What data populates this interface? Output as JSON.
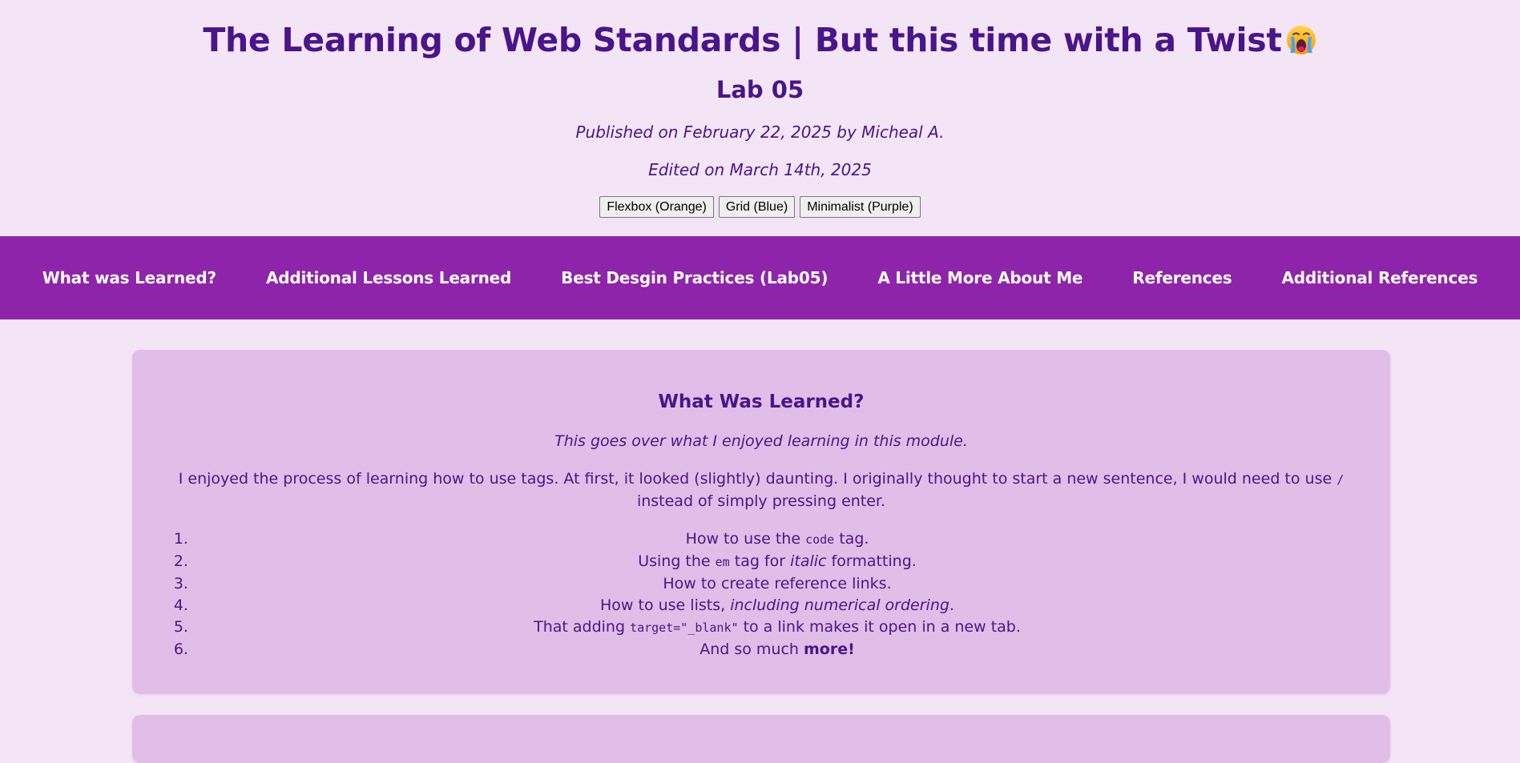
{
  "header": {
    "title": "The Learning of Web Standards | But this time with a Twist",
    "title_emoji_icon": "crying-face-emoji-icon",
    "lab_title": "Lab 05",
    "published": "Published on February 22, 2025 by Micheal A.",
    "edited": "Edited on March 14th, 2025",
    "theme_buttons": [
      "Flexbox (Orange)",
      "Grid (Blue)",
      "Minimalist (Purple)"
    ]
  },
  "nav": {
    "links": [
      "What was Learned?",
      "Additional Lessons Learned",
      "Best Desgin Practices (Lab05)",
      "A Little More About Me",
      "References",
      "Additional References"
    ]
  },
  "section_learned": {
    "title": "What Was Learned?",
    "subtitle": "This goes over what I enjoyed learning in this module.",
    "body_pre": "I enjoyed the process of learning how to use tags. At first, it looked (slightly) daunting. I originally thought to start a new sentence, I would need to use",
    "body_code": "/",
    "body_post": "instead of simply pressing enter.",
    "list": [
      {
        "pre": "How to use the ",
        "code": "code",
        "mid": " tag.",
        "em": "",
        "post": "",
        "strong": ""
      },
      {
        "pre": "Using the ",
        "code": "em",
        "mid": " tag for ",
        "em": "italic",
        "post": " formatting.",
        "strong": ""
      },
      {
        "pre": "How to create reference links.",
        "code": "",
        "mid": "",
        "em": "",
        "post": "",
        "strong": ""
      },
      {
        "pre": "How to use lists, ",
        "code": "",
        "mid": "",
        "em": "including numerical ordering",
        "post": ".",
        "strong": ""
      },
      {
        "pre": "That adding ",
        "code": "target=\"_blank\"",
        "mid": " to a link makes it open in a new tab.",
        "em": "",
        "post": "",
        "strong": ""
      },
      {
        "pre": "And so much ",
        "code": "",
        "mid": "",
        "em": "",
        "post": "",
        "strong": "more!"
      }
    ]
  },
  "colors": {
    "page_background": "#f3e5f5",
    "text": "#4a148c",
    "nav_background": "#8e24aa",
    "nav_text": "#ffffff",
    "card_background": "#e1bee7"
  }
}
